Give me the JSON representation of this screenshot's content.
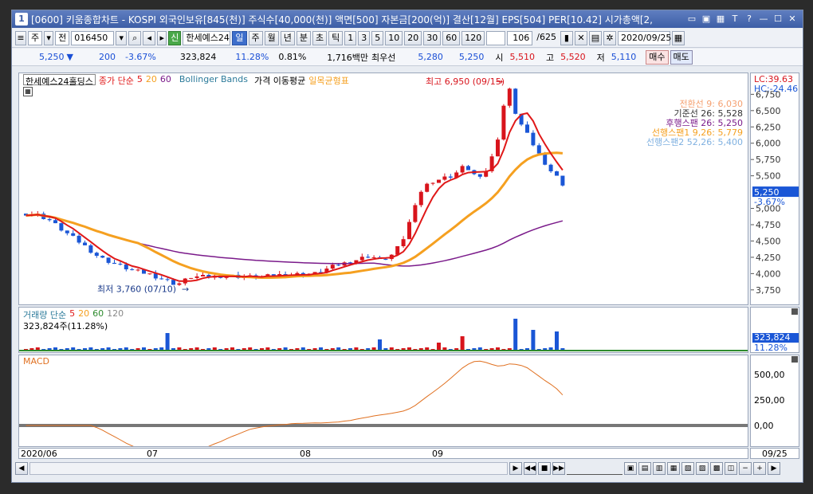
{
  "title": {
    "number": "1",
    "text": "[0600] 키움종합차트 - KOSPI 외국인보유[845(천)] 주식수[40,000(천)] 액면[500] 자본금[200(억)] 결산[12월] EPS[504] PER[10.42] 시가총액[2,"
  },
  "toolbar": {
    "period": "주",
    "type": "전",
    "code": "016450",
    "name": "한세예스24",
    "tabs": [
      "일",
      "주",
      "월",
      "년",
      "분",
      "초",
      "틱"
    ],
    "numbers": [
      "1",
      "3",
      "5",
      "10",
      "20",
      "30",
      "60",
      "120"
    ],
    "count": "106",
    "total": "/625",
    "date": "2020/09/25"
  },
  "quote": {
    "price": "5,250",
    "change": "200",
    "change_pct": "-3.67%",
    "volume": "323,824",
    "turnover_pct": "11.28%",
    "vol_ratio": "0.81%",
    "amount": "1,716백만",
    "best_bid_label": "최우선",
    "best_ask": "5,280",
    "best_bid": "5,250",
    "open_label": "시",
    "open": "5,510",
    "high_label": "고",
    "high": "5,520",
    "low_label": "저",
    "low": "5,110",
    "buy": "매수",
    "sell": "매도"
  },
  "price_panel": {
    "legend_name": "한세예스24홀딩스",
    "legend_ma": "종가 단순",
    "legend_ma_periods": [
      "5",
      "20",
      "60"
    ],
    "legend_bb": "Bollinger Bands",
    "legend_price_ma": "가격 이동평균",
    "legend_ichimoku": "일목균형표",
    "lc": "LC:39.63",
    "hc": "HC:-24.46",
    "high_annot": "최고 6,950 (09/15)",
    "low_annot": "최저 3,760 (07/10)",
    "ichimoku": [
      "전환선 9: 6,030",
      "기준선 26: 5,528",
      "후행스팬 26: 5,250",
      "선행스팬1 9,26: 5,779",
      "선행스팬2 52,26: 5,400"
    ],
    "last_price": "5,250",
    "last_pct": "-3.67%",
    "ticks": [
      "6,750",
      "6,500",
      "6,250",
      "6,000",
      "5,750",
      "5,500",
      "5,000",
      "4,750",
      "4,500",
      "4,250",
      "4,000",
      "3,750"
    ]
  },
  "volume_panel": {
    "legend": "거래량 단순",
    "periods": [
      "5",
      "20",
      "60",
      "120"
    ],
    "value_text": "323,824주(11.28%)",
    "last": "323,824",
    "last_pct": "11.28%"
  },
  "macd_panel": {
    "legend": "MACD",
    "ticks": [
      "500,00",
      "250,00",
      "0,00"
    ]
  },
  "x_axis": {
    "labels": [
      "2020/06",
      "07",
      "08",
      "09"
    ],
    "end_label": "09/25"
  },
  "colors": {
    "up": "#d8141c",
    "down": "#1a56d6",
    "ma5": "#e01818",
    "ma20": "#f5a020",
    "ma60": "#7a1a8a"
  },
  "chart_data": {
    "type": "candlestick",
    "x": [
      "2020/06",
      "07",
      "08",
      "09",
      "09/25"
    ],
    "ylim": [
      3650,
      6950
    ],
    "high": 6950,
    "low": 3760,
    "last": 5250,
    "ma_periods": [
      5,
      20,
      60
    ]
  }
}
